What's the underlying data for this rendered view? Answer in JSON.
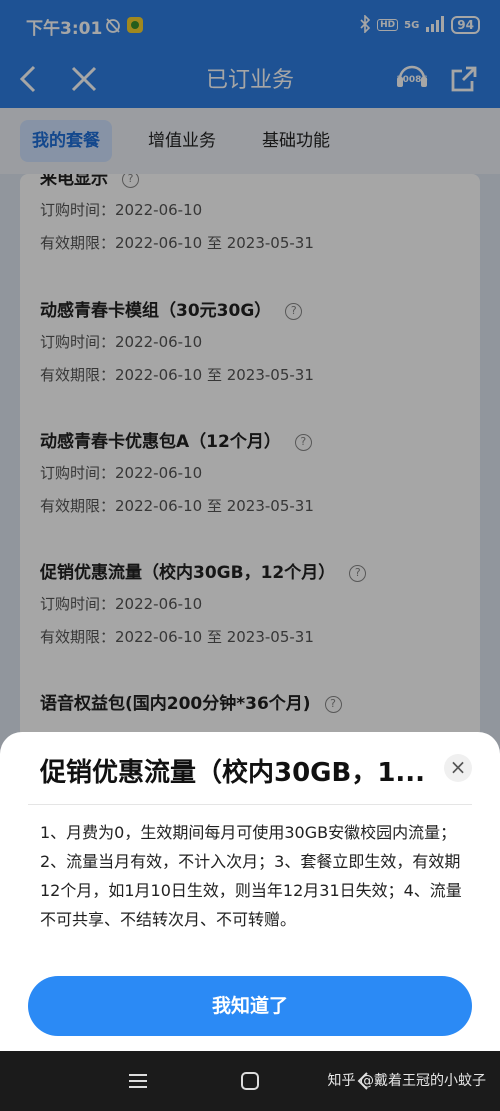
{
  "status_bar": {
    "time": "下午3:01",
    "hd_label": "HD",
    "network": "5G",
    "battery": "94"
  },
  "header": {
    "title": "已订业务",
    "service_number": "10086"
  },
  "tabs": [
    {
      "label": "我的套餐",
      "active": true
    },
    {
      "label": "增值业务",
      "active": false
    },
    {
      "label": "基础功能",
      "active": false
    }
  ],
  "packages": [
    {
      "name": "来电显示",
      "order_time": "订购时间：2022-06-10",
      "validity": "有效期限：2022-06-10 至 2023-05-31"
    },
    {
      "name": "动感青春卡模组（30元30G）",
      "order_time": "订购时间：2022-06-10",
      "validity": "有效期限：2022-06-10 至 2023-05-31"
    },
    {
      "name": "动感青春卡优惠包A（12个月）",
      "order_time": "订购时间：2022-06-10",
      "validity": "有效期限：2022-06-10 至 2023-05-31"
    },
    {
      "name": "促销优惠流量（校内30GB，12个月）",
      "order_time": "订购时间：2022-06-10",
      "validity": "有效期限：2022-06-10 至 2023-05-31"
    },
    {
      "name": "语音权益包(国内200分钟*36个月)",
      "order_time": "",
      "validity": ""
    }
  ],
  "modal": {
    "title": "促销优惠流量（校内30GB，1...",
    "close": "×",
    "body": "1、月费为0，生效期间每月可使用30GB安徽校园内流量；2、流量当月有效，不计入次月；3、套餐立即生效，有效期12个月，如1月10日生效，则当年12月31日失效；4、流量不可共享、不结转次月、不可转赠。",
    "confirm_label": "我知道了"
  },
  "watermark": "知乎 @戴着王冠的小蚊子",
  "colors": {
    "brand_blue": "#2f7fe3",
    "button_blue": "#2b8af5",
    "tab_active": "#1f6fd9"
  }
}
